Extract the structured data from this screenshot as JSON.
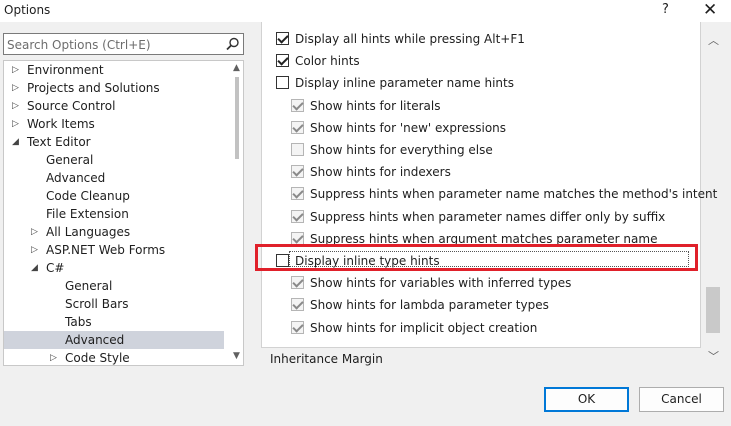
{
  "window": {
    "title": "Options",
    "help_glyph": "?",
    "close_glyph": "✕"
  },
  "search": {
    "placeholder": "Search Options (Ctrl+E)",
    "icon": "search-icon"
  },
  "tree": {
    "items": [
      {
        "label": "Environment",
        "expander": "collapsed"
      },
      {
        "label": "Projects and Solutions",
        "expander": "collapsed"
      },
      {
        "label": "Source Control",
        "expander": "collapsed"
      },
      {
        "label": "Work Items",
        "expander": "collapsed"
      },
      {
        "label": "Text Editor",
        "expander": "expanded"
      },
      {
        "label": "General",
        "expander": "none"
      },
      {
        "label": "Advanced",
        "expander": "none"
      },
      {
        "label": "Code Cleanup",
        "expander": "none"
      },
      {
        "label": "File Extension",
        "expander": "none"
      },
      {
        "label": "All Languages",
        "expander": "collapsed"
      },
      {
        "label": "ASP.NET Web Forms",
        "expander": "collapsed"
      },
      {
        "label": "C#",
        "expander": "expanded"
      },
      {
        "label": "General",
        "expander": "none"
      },
      {
        "label": "Scroll Bars",
        "expander": "none"
      },
      {
        "label": "Tabs",
        "expander": "none"
      },
      {
        "label": "Advanced",
        "expander": "none",
        "selected": true
      },
      {
        "label": "Code Style",
        "expander": "collapsed"
      }
    ],
    "selection_color": "#cfd3dc"
  },
  "options": [
    {
      "label": "Display all hints while pressing Alt+F1",
      "checked": true,
      "disabled": false
    },
    {
      "label": "Color hints",
      "checked": true,
      "disabled": false
    },
    {
      "label": "Display inline parameter name hints",
      "checked": false,
      "disabled": false
    },
    {
      "label": "Show hints for literals",
      "checked": true,
      "disabled": true
    },
    {
      "label": "Show hints for 'new' expressions",
      "checked": true,
      "disabled": true
    },
    {
      "label": "Show hints for everything else",
      "checked": false,
      "disabled": true
    },
    {
      "label": "Show hints for indexers",
      "checked": true,
      "disabled": true
    },
    {
      "label": "Suppress hints when parameter name matches the method's intent",
      "checked": true,
      "disabled": true
    },
    {
      "label": "Suppress hints when parameter names differ only by suffix",
      "checked": true,
      "disabled": true
    },
    {
      "label": "Suppress hints when argument matches parameter name",
      "checked": true,
      "disabled": true
    },
    {
      "label": "Display inline type hints",
      "checked": false,
      "disabled": false,
      "highlighted": true
    },
    {
      "label": "Show hints for variables with inferred types",
      "checked": true,
      "disabled": true
    },
    {
      "label": "Show hints for lambda parameter types",
      "checked": true,
      "disabled": true
    },
    {
      "label": "Show hints for implicit object creation",
      "checked": true,
      "disabled": true
    }
  ],
  "next_section": "Inheritance Margin",
  "highlight_color": "#e0202a",
  "buttons": {
    "ok": "OK",
    "cancel": "Cancel"
  }
}
